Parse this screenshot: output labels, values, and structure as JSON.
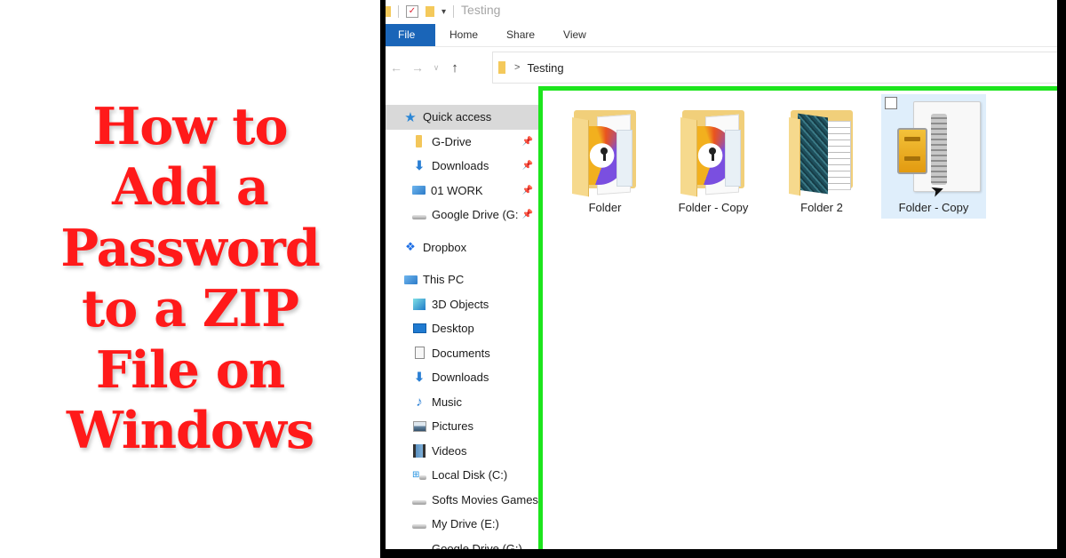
{
  "headline": {
    "lines": [
      "How to",
      "Add a",
      "Password",
      "to a ZIP",
      "File on",
      "Windows"
    ],
    "color": "#ff1a1a"
  },
  "explorer": {
    "window_title": "Testing",
    "ribbon_tabs": [
      "File",
      "Home",
      "Share",
      "View"
    ],
    "address": {
      "back_icon": "back-arrow-icon",
      "forward_icon": "forward-arrow-icon",
      "recent_icon": "chevron-down-icon",
      "up_icon": "up-arrow-icon",
      "separator": ">",
      "path": "Testing"
    },
    "nav_pane": {
      "quick_access": "Quick access",
      "pinned": [
        {
          "label": "G-Drive",
          "icon": "folder-icon"
        },
        {
          "label": "Downloads",
          "icon": "download-icon"
        },
        {
          "label": "01 WORK",
          "icon": "work-folder-icon"
        },
        {
          "label": "Google Drive (G:",
          "icon": "drive-icon"
        }
      ],
      "dropbox": "Dropbox",
      "this_pc": "This PC",
      "pc_items": [
        {
          "label": "3D Objects",
          "icon": "3d-objects-icon"
        },
        {
          "label": "Desktop",
          "icon": "desktop-icon"
        },
        {
          "label": "Documents",
          "icon": "documents-icon"
        },
        {
          "label": "Downloads",
          "icon": "download-icon"
        },
        {
          "label": "Music",
          "icon": "music-icon"
        },
        {
          "label": "Pictures",
          "icon": "pictures-icon"
        },
        {
          "label": "Videos",
          "icon": "videos-icon"
        },
        {
          "label": "Local Disk (C:)",
          "icon": "local-disk-icon"
        },
        {
          "label": "Softs Movies Games",
          "icon": "drive-icon"
        },
        {
          "label": "My Drive (E:)",
          "icon": "drive-icon"
        },
        {
          "label": "Google Drive (G:)",
          "icon": "drive-icon"
        }
      ]
    },
    "files": [
      {
        "name": "Folder",
        "type": "folder"
      },
      {
        "name": "Folder - Copy",
        "type": "folder"
      },
      {
        "name": "Folder 2",
        "type": "folder"
      },
      {
        "name": "Folder - Copy",
        "type": "zip",
        "selected": true
      }
    ],
    "highlight_color": "#1de51d",
    "file_tab_color": "#1a65b8"
  }
}
